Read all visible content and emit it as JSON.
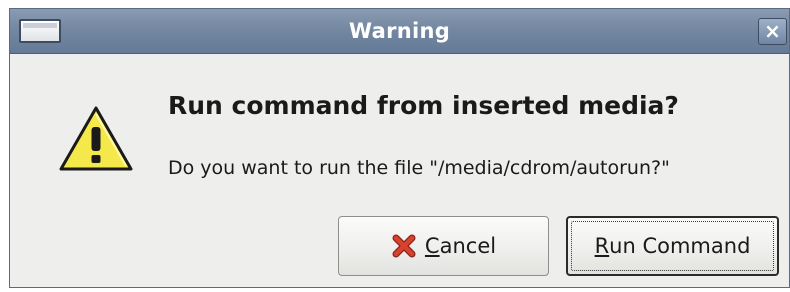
{
  "window": {
    "title": "Warning"
  },
  "titlebar": {
    "close_glyph": "×",
    "menu_icon": "window-menu-icon",
    "close_icon": "close-icon"
  },
  "dialog": {
    "icon": "warning-icon",
    "heading": "Run command from inserted media?",
    "message": "Do you want to run the file \"/media/cdrom/autorun?\""
  },
  "buttons": {
    "cancel": {
      "mnemonic": "C",
      "rest": "ancel",
      "icon": "cancel-x-icon"
    },
    "run": {
      "mnemonic": "R",
      "rest": "un Command"
    }
  },
  "colors": {
    "titlebar": "#7488a2",
    "warning_fill": "#f5e84a",
    "cancel_icon": "#c0392b"
  }
}
